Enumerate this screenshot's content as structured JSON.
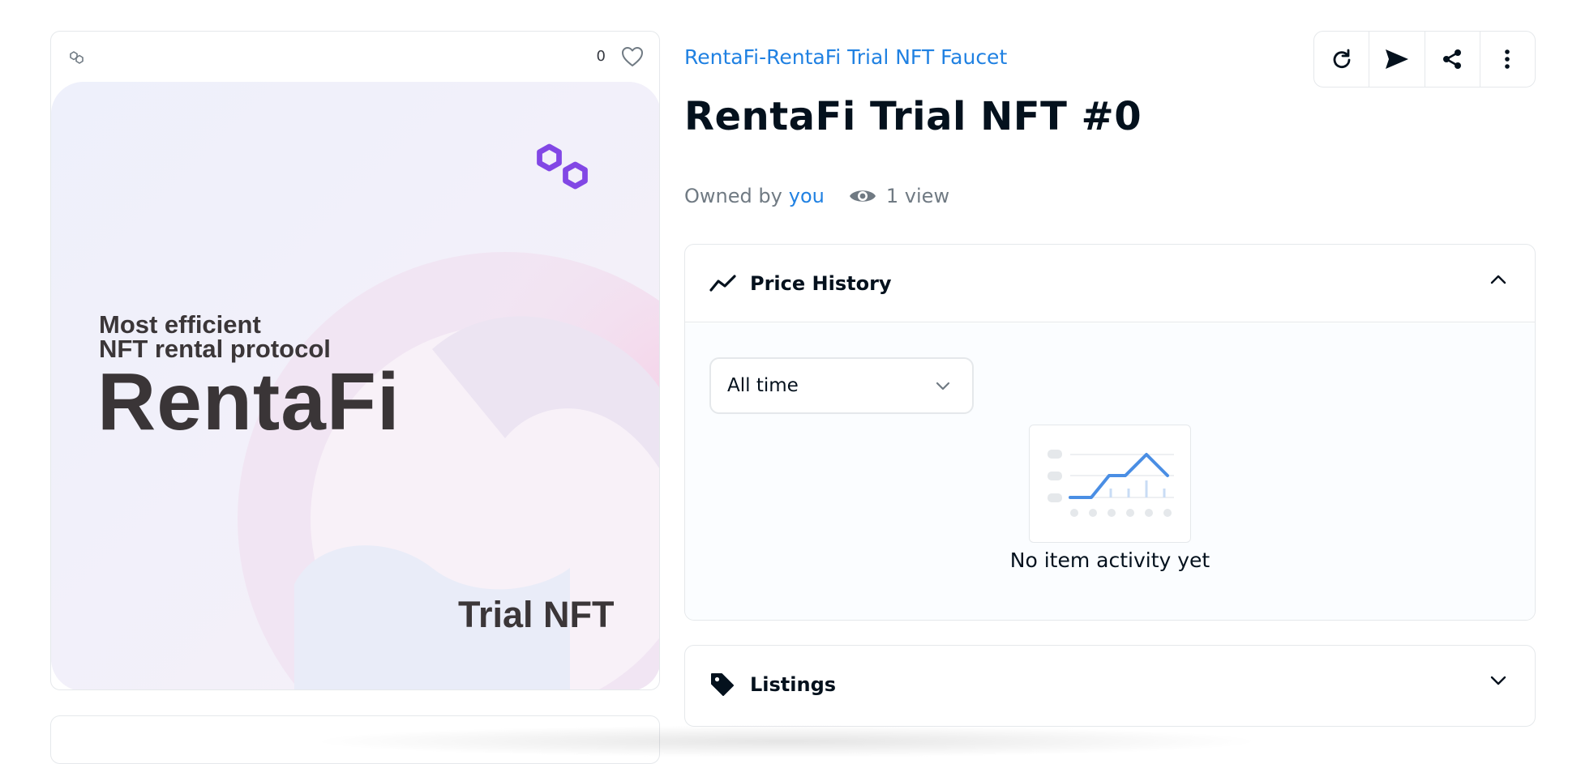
{
  "media": {
    "favorites_count": "0",
    "image_tagline_line1": "Most efficient",
    "image_tagline_line2": "NFT rental protocol",
    "image_brand": "RentaFi",
    "image_caption": "Trial NFT"
  },
  "item": {
    "collection_name": "RentaFi-RentaFi Trial NFT Faucet",
    "title": "RentaFi Trial NFT #0",
    "owned_by_label": "Owned by",
    "owner": "you",
    "views": "1 view"
  },
  "toolbar": {
    "actions": [
      "refresh-icon",
      "send-icon",
      "share-icon",
      "more-icon"
    ]
  },
  "price_history": {
    "title": "Price History",
    "filter_value": "All time",
    "empty_message": "No item activity yet"
  },
  "listings": {
    "title": "Listings"
  },
  "colors": {
    "link": "#2081e2",
    "text": "#04111d",
    "muted": "#707a83",
    "polygon_purple": "#8247e5"
  }
}
